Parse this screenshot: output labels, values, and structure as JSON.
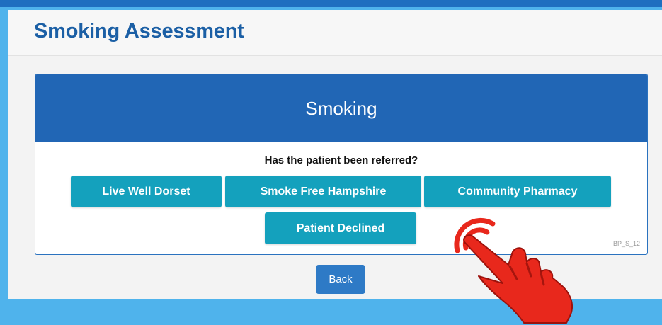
{
  "header": {
    "title": "Smoking Assessment"
  },
  "panel": {
    "title": "Smoking",
    "question": "Has the patient been referred?",
    "options": [
      "Live Well Dorset",
      "Smoke Free Hampshire",
      "Community Pharmacy",
      "Patient Declined"
    ],
    "code": "BP_S_12"
  },
  "actions": {
    "back_label": "Back"
  },
  "colors": {
    "header_blue": "#2166b5",
    "button_teal": "#14a1bd",
    "title_blue": "#1b5fa5",
    "pointer_red": "#e8281c"
  },
  "overlay": {
    "icon": "pointing-hand-icon"
  }
}
